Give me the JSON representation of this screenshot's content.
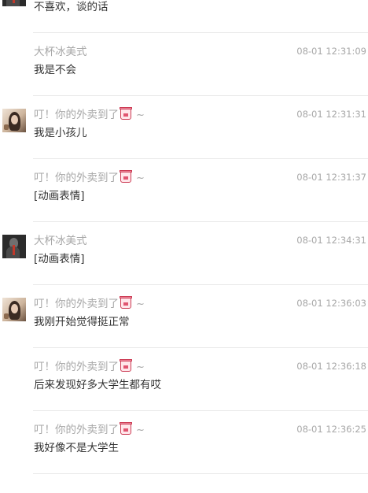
{
  "messages": [
    {
      "user": "大杯冰美式",
      "time": "",
      "text": "不喜欢，谈的话",
      "avatar": "dark",
      "show_avatar": true,
      "sticker": false
    },
    {
      "user": "大杯冰美式",
      "time": "08-01 12:31:09",
      "text": "我是不会",
      "avatar": "dark",
      "show_avatar": false,
      "sticker": false
    },
    {
      "user": "叮！你的外卖到了",
      "time": "08-01 12:31:31",
      "text": "我是小孩儿",
      "avatar": "girl",
      "show_avatar": true,
      "sticker": true
    },
    {
      "user": "叮！你的外卖到了",
      "time": "08-01 12:31:37",
      "text": "[动画表情]",
      "avatar": "girl",
      "show_avatar": false,
      "sticker": true
    },
    {
      "user": "大杯冰美式",
      "time": "08-01 12:34:31",
      "text": "[动画表情]",
      "avatar": "dark",
      "show_avatar": true,
      "sticker": false
    },
    {
      "user": "叮！你的外卖到了",
      "time": "08-01 12:36:03",
      "text": "我刚开始觉得挺正常",
      "avatar": "girl",
      "show_avatar": true,
      "sticker": true
    },
    {
      "user": "叮！你的外卖到了",
      "time": "08-01 12:36:18",
      "text": "后来发现好多大学生都有哎",
      "avatar": "girl",
      "show_avatar": false,
      "sticker": true
    },
    {
      "user": "叮！你的外卖到了",
      "time": "08-01 12:36:25",
      "text": "我好像不是大学生",
      "avatar": "girl",
      "show_avatar": false,
      "sticker": true
    }
  ],
  "name_suffix": "~",
  "colors": {
    "meta": "#a7a7a7",
    "text": "#333333",
    "divider": "#e8e8e8",
    "sticker": "#cc3d55"
  }
}
